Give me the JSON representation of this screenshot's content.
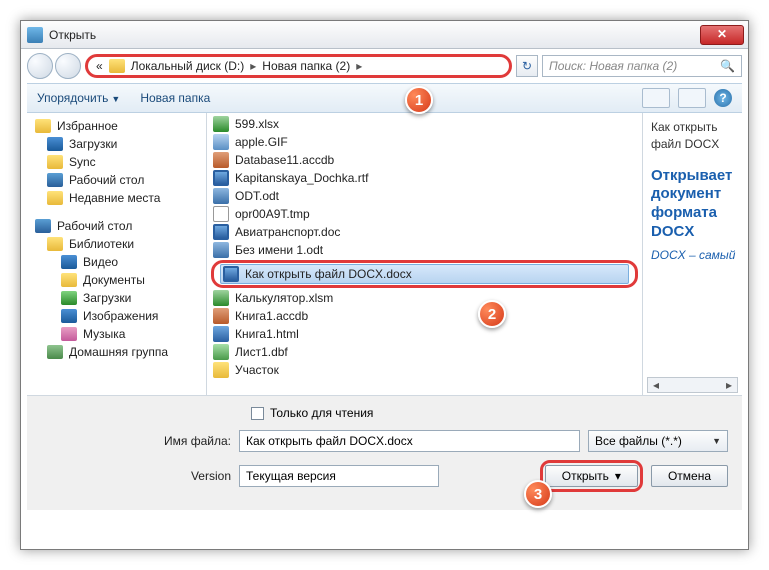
{
  "window": {
    "title": "Открыть"
  },
  "breadcrumb": {
    "prefix": "«",
    "seg1": "Локальный диск (D:)",
    "seg2": "Новая папка (2)"
  },
  "search": {
    "placeholder": "Поиск: Новая папка (2)"
  },
  "toolbar": {
    "organize": "Упорядочить",
    "newfolder": "Новая папка"
  },
  "tree": {
    "fav": "Избранное",
    "fav_items": [
      "Загрузки",
      "Sync",
      "Рабочий стол",
      "Недавние места"
    ],
    "desk": "Рабочий стол",
    "lib": "Библиотеки",
    "lib_items": [
      "Видео",
      "Документы",
      "Загрузки",
      "Изображения",
      "Музыка"
    ],
    "home": "Домашняя группа"
  },
  "files": {
    "before": [
      {
        "n": "599.xlsx",
        "c": "fi-x"
      },
      {
        "n": "apple.GIF",
        "c": "fi-img"
      },
      {
        "n": "Database11.accdb",
        "c": "fi-db"
      },
      {
        "n": "Kapitanskaya_Dochka.rtf",
        "c": "fi-doc"
      },
      {
        "n": "ODT.odt",
        "c": "fi-odt"
      },
      {
        "n": "opr00A9T.tmp",
        "c": "fi-txt"
      },
      {
        "n": "Авиатранспорт.doc",
        "c": "fi-doc"
      },
      {
        "n": "Без имени 1.odt",
        "c": "fi-odt"
      }
    ],
    "selected": {
      "n": "Как открыть файл DOCX.docx",
      "c": "fi-doc"
    },
    "after": [
      {
        "n": "Калькулятор.xlsm",
        "c": "fi-x"
      },
      {
        "n": "Книга1.accdb",
        "c": "fi-db"
      },
      {
        "n": "Книга1.html",
        "c": "fi-html"
      },
      {
        "n": "Лист1.dbf",
        "c": "fi-dbf"
      },
      {
        "n": "Участок",
        "c": "fi-fold"
      }
    ]
  },
  "preview": {
    "line1": "Как открыть файл DOCX",
    "heading": "Открывает документ формата DOCX",
    "italic": "DOCX – самый"
  },
  "readonly": "Только для чтения",
  "form": {
    "fnlabel": "Имя файла:",
    "fnvalue": "Как открыть файл DOCX.docx",
    "filter": "Все файлы (*.*)",
    "verlabel": "Version",
    "verval": "Текущая версия",
    "open": "Открыть",
    "cancel": "Отмена"
  },
  "callouts": {
    "c1": "1",
    "c2": "2",
    "c3": "3"
  }
}
